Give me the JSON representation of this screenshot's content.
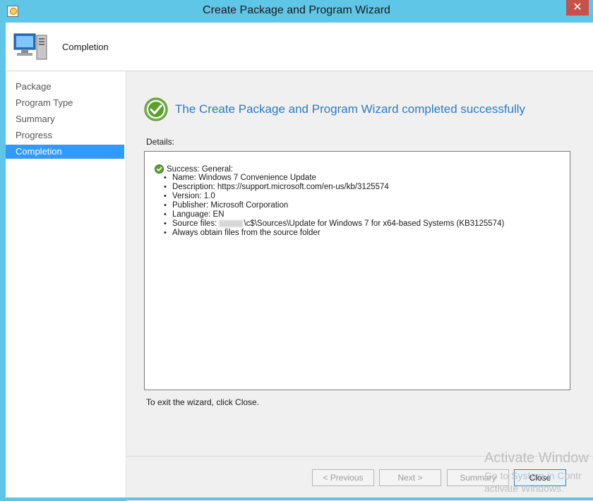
{
  "window": {
    "title": "Create Package and Program Wizard",
    "close_glyph": "✕"
  },
  "header": {
    "page_title": "Completion"
  },
  "nav": {
    "items": [
      {
        "label": "Package"
      },
      {
        "label": "Program Type"
      },
      {
        "label": "Summary"
      },
      {
        "label": "Progress"
      },
      {
        "label": "Completion",
        "active": true
      }
    ]
  },
  "main": {
    "success_message": "The Create Package and Program Wizard completed successfully",
    "details_label": "Details:",
    "details": {
      "status_line": "Success: General:",
      "bullets": [
        "Name: Windows 7 Convenience Update",
        "Description: https://support.microsoft.com/en-us/kb/3125574",
        "Version: 1.0",
        "Publisher: Microsoft Corporation",
        "Language: EN"
      ],
      "source_files_prefix": "Source files: ",
      "source_files_path": "\\c$\\Sources\\Update for Windows 7 for x64-based Systems (KB3125574)",
      "last_bullet": "Always obtain files from the source folder"
    },
    "exit_instruction": "To exit the wizard, click Close."
  },
  "buttons": {
    "previous": "< Previous",
    "next": "Next >",
    "summary": "Summary",
    "close": "Close"
  },
  "watermark": {
    "line1": "Activate Window",
    "line2": "Go to System in Contr",
    "line3": "activate Windows."
  },
  "colors": {
    "titlebar": "#5fc6e8",
    "accent": "#2a7cc6",
    "nav_active": "#3399ff"
  }
}
